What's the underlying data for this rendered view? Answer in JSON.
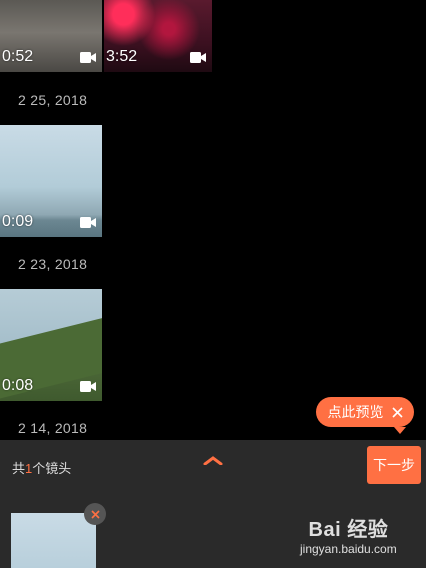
{
  "gallery": {
    "clips": [
      {
        "duration": "0:52"
      },
      {
        "duration": "3:52"
      },
      {
        "duration": "0:09"
      },
      {
        "duration": "0:08"
      }
    ],
    "dates": [
      "2 25, 2018",
      "2 23, 2018",
      "2 14, 2018"
    ]
  },
  "preview_tip": {
    "label": "点此预览"
  },
  "bottom_bar": {
    "count_prefix": "共",
    "count_value": "1",
    "count_suffix": "个镜头",
    "next_label": "下一步"
  },
  "watermark": {
    "logo": "Bai 经验",
    "url": "jingyan.baidu.com"
  },
  "colors": {
    "accent": "#ff7043",
    "background": "#000000",
    "bar": "#2a2a2a"
  }
}
